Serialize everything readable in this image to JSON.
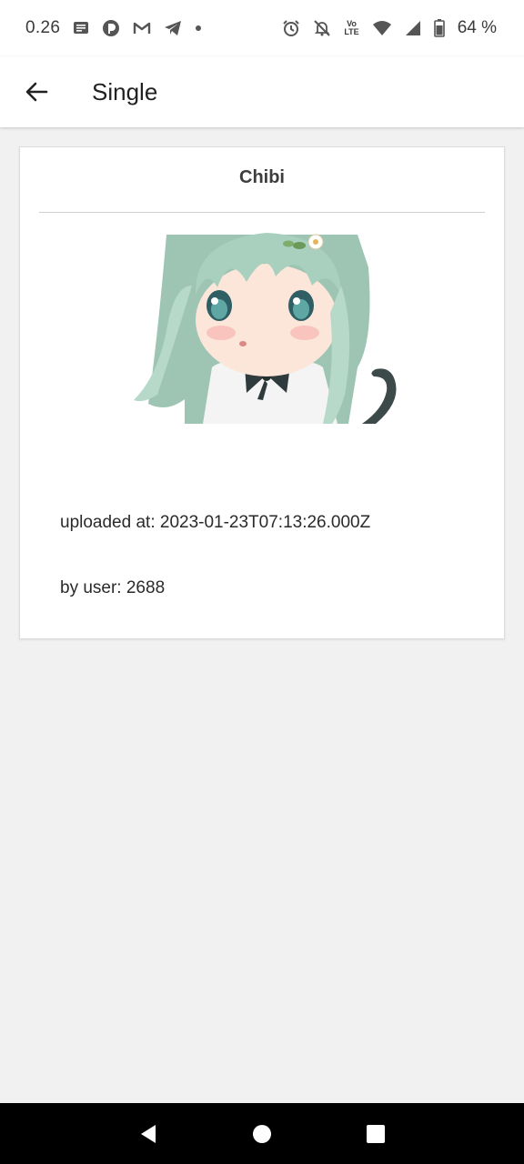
{
  "status_bar": {
    "time": "0.26",
    "volte_top": "Vo",
    "volte_bottom": "LTE",
    "battery": "64 %",
    "left_icons": [
      "message-icon",
      "app-icon",
      "gmail-icon",
      "telegram-icon",
      "dot-icon"
    ],
    "right_icons": [
      "alarm-icon",
      "notifications-off-icon",
      "volte-icon",
      "wifi-icon",
      "signal-icon",
      "battery-icon"
    ]
  },
  "app_bar": {
    "title": "Single",
    "back_icon": "arrow-back-icon"
  },
  "card": {
    "title": "Chibi",
    "image": "chibi-character-image",
    "uploaded_at": "uploaded at: 2023-01-23T07:13:26.000Z",
    "by_user": "by user: 2688"
  },
  "nav_bar": {
    "icons": [
      "back-triangle-icon",
      "home-circle-icon",
      "recents-square-icon"
    ]
  },
  "colors": {
    "background": "#f1f1f1",
    "surface": "#ffffff",
    "text": "#212121",
    "nav": "#000000"
  }
}
